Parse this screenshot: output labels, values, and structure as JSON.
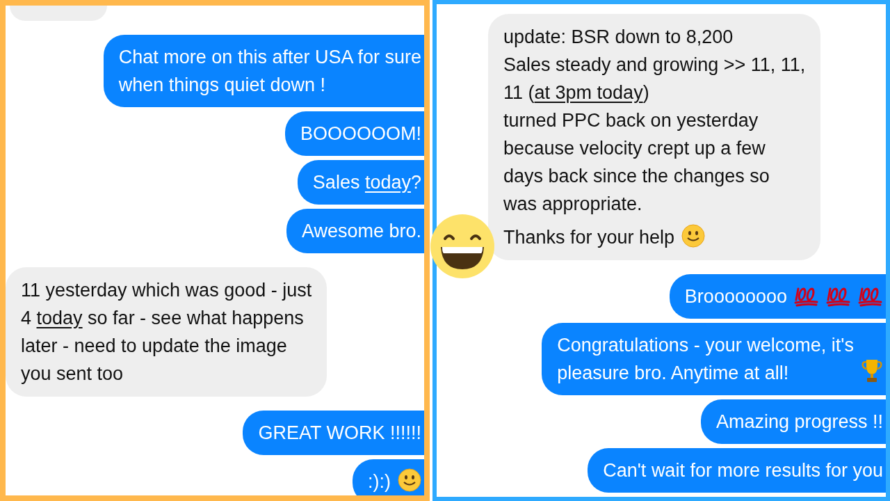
{
  "panels": [
    {
      "messages": [
        {
          "sent": false,
          "kind": "cut"
        },
        {
          "sent": true,
          "kind": "plain",
          "paragraphs": [
            [
              {
                "text": "Chat more on this after USA for sure\nwhen things quiet down !",
                "underlined": false
              }
            ]
          ]
        },
        {
          "sent": true,
          "kind": "plain",
          "paragraphs": [
            [
              {
                "text": "BOOOOOOM!",
                "underlined": false
              }
            ]
          ]
        },
        {
          "sent": true,
          "kind": "plain",
          "paragraphs": [
            [
              {
                "text": "Sales ",
                "underlined": false
              },
              {
                "text": "today",
                "underlined": true
              },
              {
                "text": "?",
                "underlined": false
              }
            ]
          ]
        },
        {
          "sent": true,
          "kind": "plain",
          "paragraphs": [
            [
              {
                "text": "Awesome bro.",
                "underlined": false
              }
            ]
          ]
        },
        {
          "sent": false,
          "kind": "plain",
          "paragraphs": [
            [
              {
                "text": "11 yesterday which was good - just\n4 ",
                "underlined": false
              },
              {
                "text": "today",
                "underlined": true
              },
              {
                "text": " so far - see what happens\nlater - need to update the image\nyou sent too",
                "underlined": false
              }
            ]
          ]
        },
        {
          "sent": true,
          "kind": "plain",
          "paragraphs": [
            [
              {
                "text": "GREAT WORK !!!!!!",
                "underlined": false
              }
            ]
          ]
        },
        {
          "sent": true,
          "kind": "smile",
          "paragraphs": [
            [
              {
                "text": ":):)",
                "underlined": false
              }
            ]
          ]
        }
      ]
    },
    {
      "messages": [
        {
          "sent": false,
          "kind": "smile",
          "paragraphs": [
            [
              {
                "text": "update: BSR down to 8,200\nSales steady and growing >> 11, 11,\n11 (",
                "underlined": false
              },
              {
                "text": "at 3pm today",
                "underlined": true
              },
              {
                "text": ")\nturned PPC back on yesterday\nbecause velocity crept up a few\ndays back since the changes so\nwas appropriate.",
                "underlined": false
              }
            ],
            [
              {
                "text": "Thanks for your help",
                "underlined": false
              }
            ]
          ]
        },
        {
          "sent": true,
          "kind": "hundreds",
          "paragraphs": [
            [
              {
                "text": "Broooooooo",
                "underlined": false
              }
            ]
          ]
        },
        {
          "sent": true,
          "kind": "trophy",
          "paragraphs": [
            [
              {
                "text": "Congratulations - your welcome, it's\npleasure bro. Anytime at all!",
                "underlined": false
              }
            ]
          ]
        },
        {
          "sent": true,
          "kind": "plain",
          "paragraphs": [
            [
              {
                "text": "Amazing progress !!",
                "underlined": false
              }
            ]
          ]
        },
        {
          "sent": true,
          "kind": "plain",
          "paragraphs": [
            [
              {
                "text": "Can't wait for more results for you",
                "underlined": false
              }
            ]
          ]
        }
      ]
    }
  ]
}
